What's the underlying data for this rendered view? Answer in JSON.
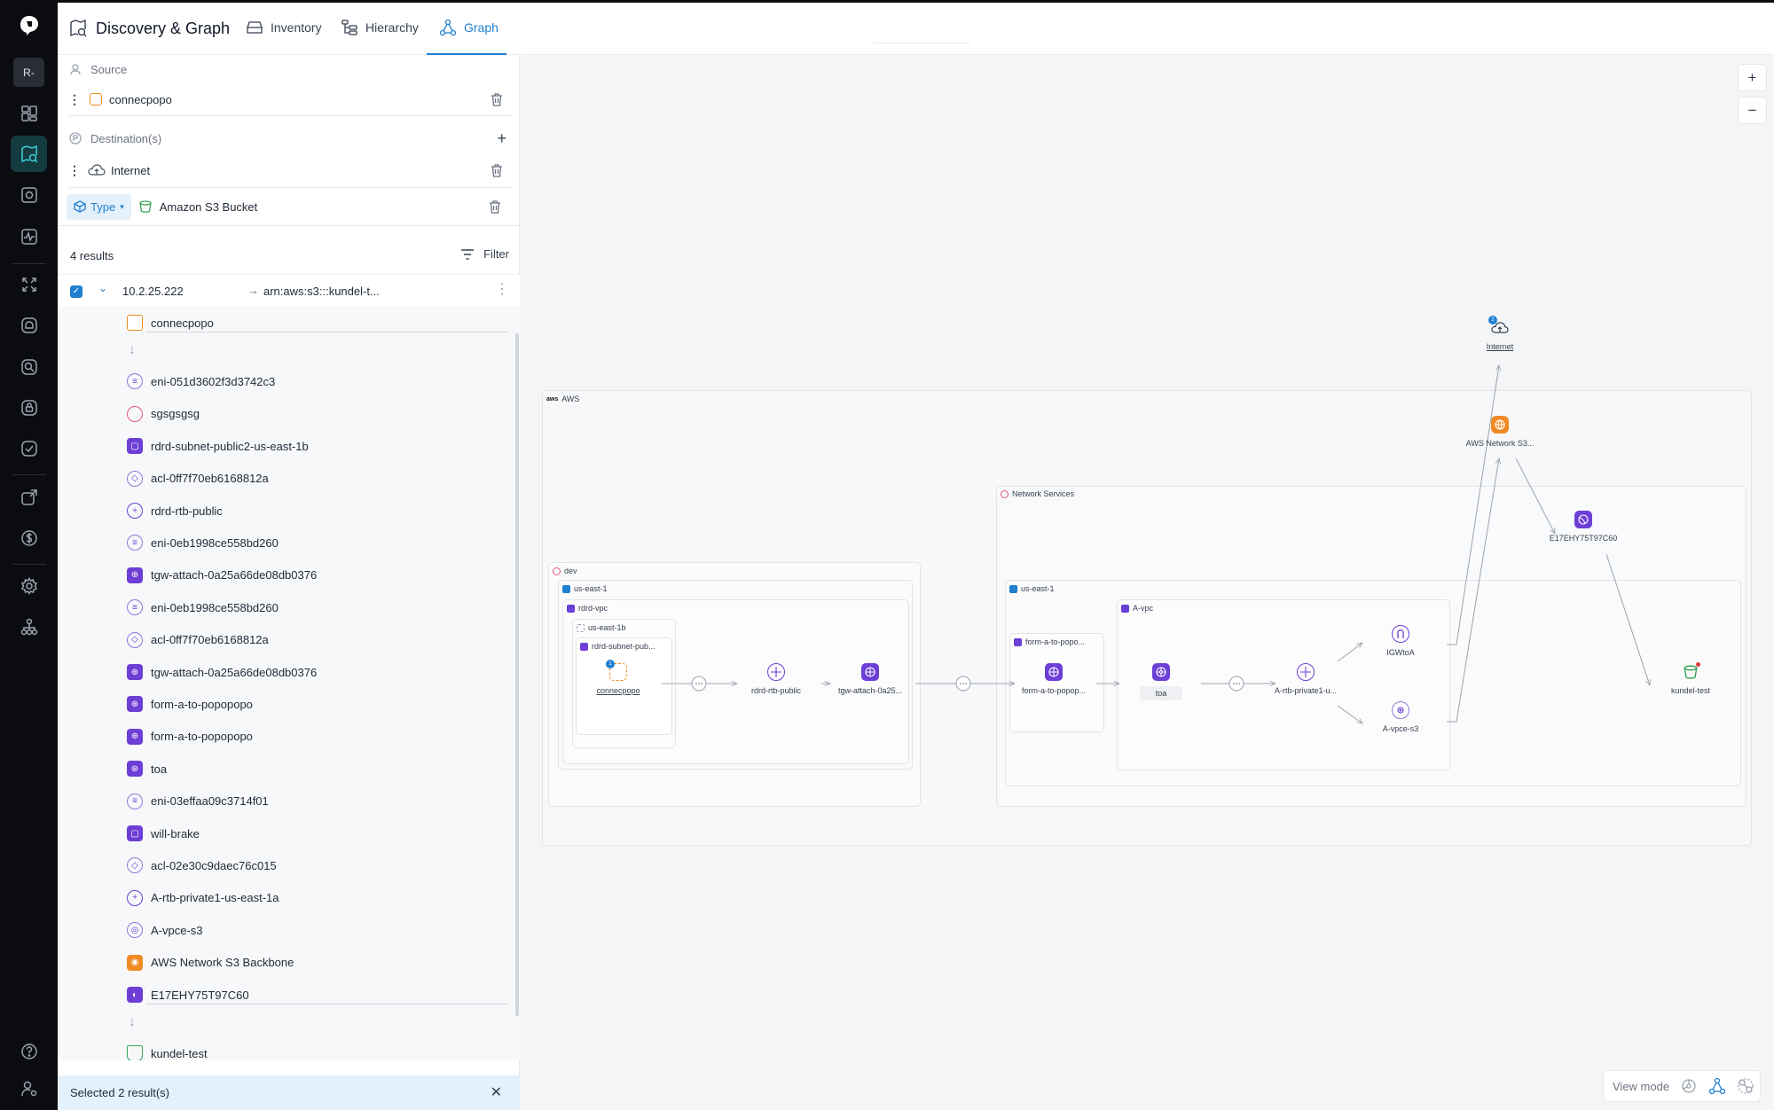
{
  "rail": {
    "workspace": "R-",
    "items": [
      "home",
      "inventory",
      "discovery",
      "monitor",
      "activity",
      "integrations",
      "alerts",
      "search",
      "security",
      "compliance",
      "automation",
      "billing",
      "settings",
      "org"
    ],
    "active": "discovery"
  },
  "header": {
    "title": "Discovery & Graph",
    "tabs": [
      {
        "label": "Inventory",
        "active": false
      },
      {
        "label": "Hierarchy",
        "active": false
      },
      {
        "label": "Graph",
        "active": true
      }
    ]
  },
  "panel": {
    "source_label": "Source",
    "source_value": "connecpopo",
    "destination_label": "Destination(s)",
    "destination_value": "Internet",
    "type_label": "Type",
    "type_value": "Amazon S3 Bucket",
    "results_count": "4 results",
    "filter_label": "Filter",
    "result": {
      "source_ip": "10.2.25.222",
      "target": "arn:aws:s3:::kundel-t..."
    },
    "hops": [
      {
        "label": "connecpopo",
        "icon": "instance"
      },
      {
        "label": "eni-051d3602f3d3742c3",
        "icon": "eni"
      },
      {
        "label": "sgsgsgsg",
        "icon": "security-group"
      },
      {
        "label": "rdrd-subnet-public2-us-east-1b",
        "icon": "subnet"
      },
      {
        "label": "acl-0ff7f70eb6168812a",
        "icon": "acl"
      },
      {
        "label": "rdrd-rtb-public",
        "icon": "route-table"
      },
      {
        "label": "eni-0eb1998ce558bd260",
        "icon": "eni"
      },
      {
        "label": "tgw-attach-0a25a66de08db0376",
        "icon": "tgw-attach"
      },
      {
        "label": "eni-0eb1998ce558bd260",
        "icon": "eni"
      },
      {
        "label": "acl-0ff7f70eb6168812a",
        "icon": "acl"
      },
      {
        "label": "tgw-attach-0a25a66de08db0376",
        "icon": "tgw-attach"
      },
      {
        "label": "form-a-to-popopopo",
        "icon": "tgw-attach"
      },
      {
        "label": "form-a-to-popopopo",
        "icon": "tgw-attach"
      },
      {
        "label": "toa",
        "icon": "tgw"
      },
      {
        "label": "eni-03effaa09c3714f01",
        "icon": "eni"
      },
      {
        "label": "will-brake",
        "icon": "subnet"
      },
      {
        "label": "acl-02e30c9daec76c015",
        "icon": "acl"
      },
      {
        "label": "A-rtb-private1-us-east-1a",
        "icon": "route-table"
      },
      {
        "label": "A-vpce-s3",
        "icon": "vpce"
      },
      {
        "label": "AWS Network S3 Backbone",
        "icon": "backbone"
      },
      {
        "label": "E17EHY75T97C60",
        "icon": "cloudfront"
      },
      {
        "label": "kundel-test",
        "icon": "bucket"
      }
    ],
    "footer": "Selected 2 result(s)"
  },
  "graph": {
    "zoom_in": "+",
    "zoom_out": "−",
    "groups": {
      "aws": "AWS",
      "network_services": "Network Services",
      "dev": "dev",
      "dev_region": "us-east-1",
      "dev_vpc": "rdrd-vpc",
      "dev_az": "us-east-1b",
      "dev_subnet": "rdrd-subnet-pub...",
      "ns_region": "us-east-1",
      "ns_vpc": "A-vpc",
      "ns_subnet": "form-a-to-popo..."
    },
    "nodes": {
      "internet": "Internet",
      "backbone": "AWS Network S3...",
      "cloudfront": "E17EHY75T97C60",
      "source": "connecpopo",
      "rtb_public": "rdrd-rtb-public",
      "tgw_attach": "tgw-attach-0a25...",
      "form_a": "form-a-to-popop...",
      "toa": "toa",
      "rtb_private": "A-rtb-private1-u...",
      "igw": "IGWtoA",
      "vpce": "A-vpce-s3",
      "bucket": "kundel-test"
    },
    "view_mode": "View mode"
  },
  "colors": {
    "accent": "#1f7fd1",
    "purple": "#6d3fd6",
    "orange": "#f08a24",
    "green": "#3aa55a"
  }
}
